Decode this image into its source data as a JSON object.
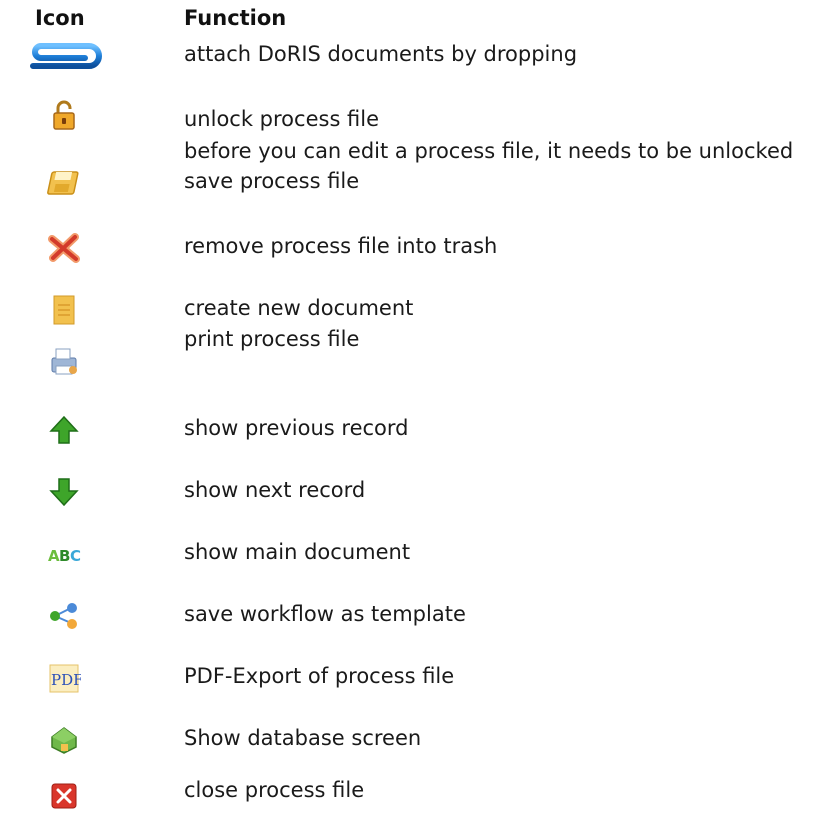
{
  "header": {
    "icon_label": "Icon",
    "function_label": "Function"
  },
  "rows": [
    {
      "icon": "paperclip-icon",
      "lines": [
        "attach DoRIS documents by dropping"
      ]
    },
    {
      "icon": "unlock-icon",
      "lines": [
        "unlock process file",
        "before you can edit a process file, it needs to be unlocked"
      ]
    },
    {
      "icon": "save-disk-icon",
      "lines": [
        "save process file"
      ]
    },
    {
      "icon": "delete-x-icon",
      "lines": [
        "remove process file into trash"
      ]
    },
    {
      "icon": "new-document-icon",
      "lines": [
        "create new document"
      ]
    },
    {
      "icon": "printer-icon",
      "lines": [
        "print process file"
      ]
    },
    {
      "icon": "arrow-up-icon",
      "lines": [
        "show previous record"
      ]
    },
    {
      "icon": "arrow-down-icon",
      "lines": [
        "show next record"
      ]
    },
    {
      "icon": "abc-icon",
      "lines": [
        "show main document"
      ]
    },
    {
      "icon": "workflow-icon",
      "lines": [
        "save workflow as template"
      ]
    },
    {
      "icon": "pdf-icon",
      "lines": [
        "PDF-Export of process file"
      ]
    },
    {
      "icon": "database-icon",
      "lines": [
        "Show database screen"
      ]
    },
    {
      "icon": "close-icon",
      "lines": [
        "close process file"
      ]
    }
  ],
  "colors": {
    "paperclip": "#1f7fd8",
    "arrow_green": "#3ea52a",
    "close_red": "#d9362b",
    "folder_yellow": "#f2c14e"
  }
}
